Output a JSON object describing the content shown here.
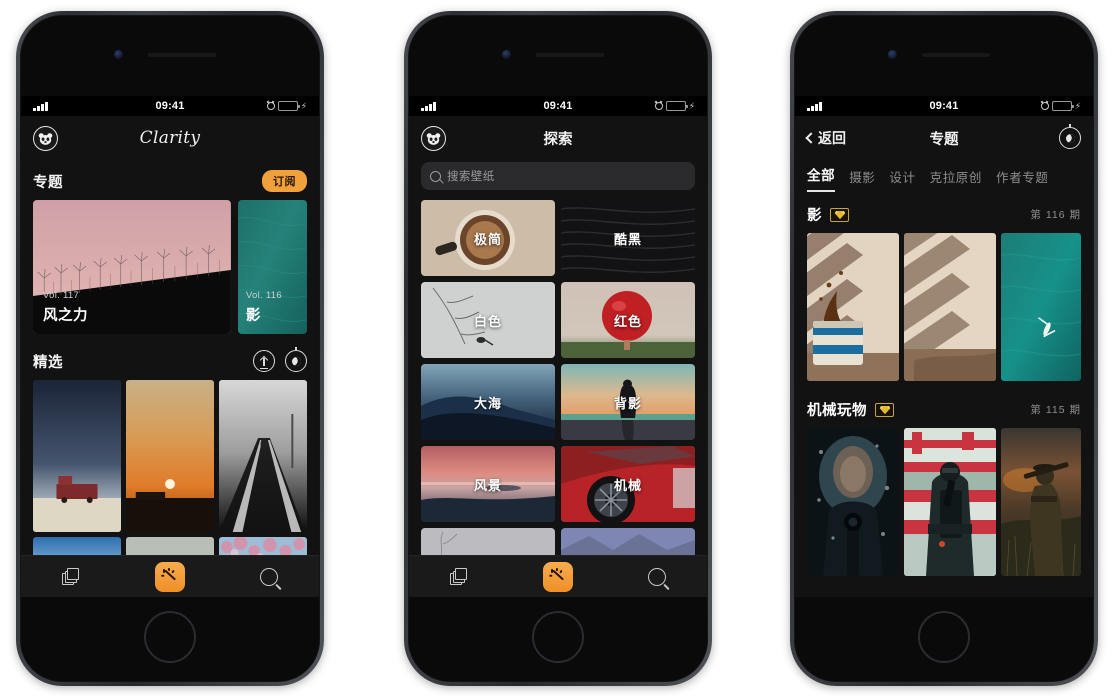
{
  "app": {
    "name": "Clarity",
    "accent": "#f0a13c",
    "background": "#121212"
  },
  "status_bar": {
    "time": "09:41",
    "alarm_icon": "alarm-icon",
    "battery_icon": "battery-icon",
    "charging_icon": "bolt-icon",
    "signal_icon": "signal-bars-icon"
  },
  "phone1": {
    "nav": {
      "avatar_icon": "panda-avatar-icon",
      "title": "Clarity"
    },
    "sections": [
      {
        "title": "专题",
        "action_label": "订阅",
        "cards": [
          {
            "volume": "Vol. 117",
            "name": "风之力",
            "image": "windmills-pink-sky"
          },
          {
            "volume": "Vol. 116",
            "name": "影",
            "image": "teal-water-texture"
          }
        ]
      },
      {
        "title": "精选",
        "icons": [
          "upload-circle-icon",
          "night-mode-icon"
        ],
        "thumbs": [
          "blue-sky-red-truck-field",
          "orange-sunset-horizon",
          "foggy-road-monochrome",
          "blue-sky-ocean",
          "pale-minimal-gradient",
          "cherry-blossom-pink"
        ]
      }
    ],
    "tabbar": {
      "items": [
        "stack-icon",
        "magic-wand-icon",
        "search-icon"
      ],
      "active_index": 1
    }
  },
  "phone2": {
    "nav": {
      "avatar_icon": "panda-avatar-icon",
      "title": "探索"
    },
    "search": {
      "placeholder": "搜索壁纸",
      "icon": "search-icon"
    },
    "categories": [
      {
        "label": "极简",
        "image": "coffee-cup-beige"
      },
      {
        "label": "酷黑",
        "image": "dark-black-texture"
      },
      {
        "label": "白色",
        "image": "white-branch-bird"
      },
      {
        "label": "红色",
        "image": "red-balloon"
      },
      {
        "label": "大海",
        "image": "blue-cliff-sea"
      },
      {
        "label": "背影",
        "image": "silhouette-beach-sunset"
      },
      {
        "label": "风景",
        "image": "pink-lake-landscape"
      },
      {
        "label": "机械",
        "image": "red-sports-car-wheel"
      },
      {
        "label": "",
        "image": "pale-tree-snow"
      },
      {
        "label": "",
        "image": "mountain-range-blue"
      }
    ],
    "tabbar": {
      "items": [
        "stack-icon",
        "magic-wand-icon",
        "search-icon"
      ],
      "active_index": 1
    }
  },
  "phone3": {
    "nav": {
      "back_label": "返回",
      "title": "专题",
      "right_icon": "night-mode-icon"
    },
    "segments": [
      "全部",
      "摄影",
      "设计",
      "克拉原创",
      "作者专题"
    ],
    "active_segment": "全部",
    "topics": [
      {
        "title": "影",
        "badge_icon": "gem-icon",
        "issue": "第 116 期",
        "images": [
          "blinds-shadow-splash-cup",
          "blinds-shadow-wall",
          "teal-water-swimmer"
        ]
      },
      {
        "title": "机械玩物",
        "badge_icon": "gem-icon",
        "issue": "第 115 期",
        "images": [
          "soldier-aiming-snow",
          "soldier-red-wall",
          "officer-field-dusk"
        ]
      }
    ]
  }
}
